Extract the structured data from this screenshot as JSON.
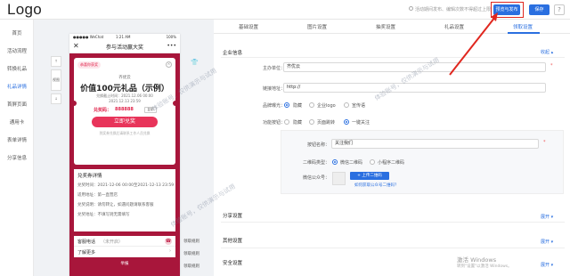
{
  "topbar": {
    "logo": "Logo",
    "notice": "活动期间发布、编辑次数不得超过上限",
    "preview_publish": "预览与发布",
    "save": "保存",
    "help": "?"
  },
  "sidebar": {
    "items": [
      "首页",
      "活动流程",
      "转换礼品",
      "礼品详情",
      "首屏页面",
      "通用卡",
      "表单详情",
      "分享信息"
    ],
    "active_index": 3
  },
  "phone": {
    "status_left": "●●●●● WeChat",
    "status_time": "1:21 AM",
    "status_right": "100%",
    "nav_close": "✕",
    "nav_title": "参与活动赢大奖",
    "nav_more": "•••",
    "card": {
      "badge": "恭喜你获奖",
      "close": "×",
      "brand": "齐优云",
      "title": "价值100元礼品（示例）",
      "deadline_1": "兑换截止时间：2021.12.06 00:00",
      "deadline_2": "2021.12.13 23:59",
      "code_label": "兑奖码：",
      "code": "888888",
      "copy": "复制",
      "button": "立即兑奖",
      "hint": "到奖券兑换后请联系工作人员兑换"
    },
    "details": {
      "title": "兑奖券详情",
      "rows": [
        "兑奖时间：2021-12-06 00:00至2021-12-13 23:59",
        "适用地址：第一直营店",
        "兑奖说明：请勿转让，如遇问题请联系客服",
        "兑奖地址：不填写则无需填写"
      ]
    },
    "contact_label": "客服电话",
    "contact_value": "（未开启）",
    "contact_icon": "☎",
    "more_label": "了解更多",
    "more_arrow": "›",
    "report": "举报",
    "left_controls": [
      "↑",
      "视图",
      "↓"
    ],
    "right_labels": [
      "领取规则",
      "领取规则",
      "领取规则"
    ],
    "wear_icon": "👕"
  },
  "panel": {
    "tabs": [
      "基础设置",
      "图片设置",
      "抽奖设置",
      "礼品设置",
      "领取设置"
    ],
    "active_tab": 4,
    "section_enterprise": "企业信息",
    "collapse": "收起 ▴",
    "fields": {
      "host_label": "主办单位：",
      "host_value": "齐优云",
      "link_label": "链接地址：",
      "link_value": "http://",
      "brand_label": "品牌曝光：",
      "brand_options": [
        "隐藏",
        "企业logo",
        "宣传语"
      ],
      "brand_selected": 0,
      "func_label": "功能按钮：",
      "func_options": [
        "隐藏",
        "页面跳转",
        "一键关注"
      ],
      "func_selected": 2,
      "btn_name_label": "按钮名称：",
      "btn_name_value": "关注我们",
      "qr_type_label": "二维码类型：",
      "qr_type_options": [
        "微信二维码",
        "小程序二维码"
      ],
      "qr_type_selected": 0,
      "wx_label": "微信公众号：",
      "upload": "+ 上传二维码",
      "qr_help": "如何获取公众号二维码？"
    },
    "section_share": "分享设置",
    "section_other": "其他设置",
    "section_security": "安全设置",
    "expand": "展开 ▾",
    "required_mark": "*"
  },
  "watermarks": [
    "体验账号，仅供演示与试用",
    "体验账号，仅供演示与试用",
    "体验账号，仅供演示与试用"
  ],
  "system": {
    "activate": "激活 Windows",
    "activate_sub": "转到\"设置\"以激活 Windows。"
  },
  "colors": {
    "accent": "#2a6fe0",
    "annotation": "#e0271f",
    "page_bg": "#a8163b"
  }
}
